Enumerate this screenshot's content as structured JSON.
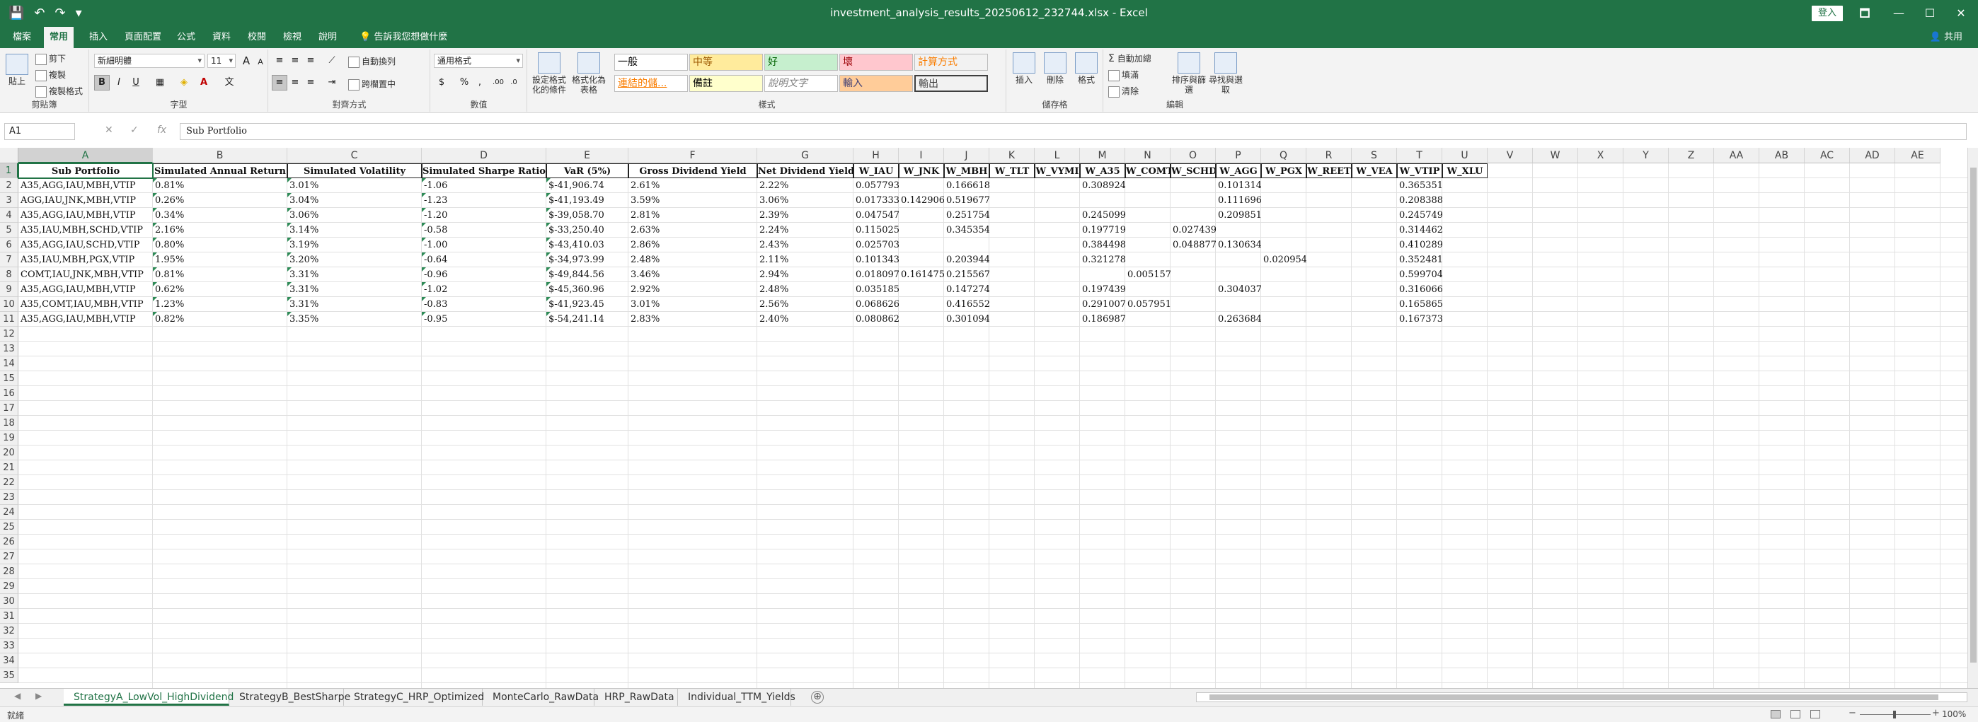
{
  "window": {
    "title": "investment_analysis_results_20250612_232744.xlsx  -  Excel",
    "sign_in": "登入",
    "share": "共用",
    "controls": [
      "🗖",
      "—",
      "☐",
      "✕"
    ]
  },
  "qat": [
    "💾",
    "↶",
    "↷",
    "▾"
  ],
  "ribbon_tabs": [
    "檔案",
    "常用",
    "插入",
    "頁面配置",
    "公式",
    "資料",
    "校閱",
    "檢視",
    "說明"
  ],
  "tell_me": "告訴我您想做什麼",
  "ribbon": {
    "clipboard": {
      "paste": "貼上",
      "cut": "剪下",
      "copy": "複製",
      "format_painter": "複製格式",
      "label": "剪貼簿"
    },
    "font": {
      "name": "新細明體",
      "size": "11",
      "label": "字型",
      "bold": "B",
      "italic": "I",
      "underline": "U",
      "grow": "A",
      "shrink": "A"
    },
    "alignment": {
      "wrap": "自動換列",
      "merge": "跨欄置中",
      "label": "對齊方式"
    },
    "number": {
      "format": "通用格式",
      "currency": "$",
      "percent": "%",
      "comma": ",",
      "label": "數值"
    },
    "styles": {
      "conditional": "設定格式化的條件",
      "table": "格式化為表格",
      "cells": [
        {
          "text": "一般",
          "bg": "#ffffff",
          "fg": "#000000"
        },
        {
          "text": "中等",
          "bg": "#ffeb9c",
          "fg": "#9c5700"
        },
        {
          "text": "好",
          "bg": "#c6efce",
          "fg": "#006100"
        },
        {
          "text": "壞",
          "bg": "#ffc7ce",
          "fg": "#9c0006"
        },
        {
          "text": "計算方式",
          "bg": "#f2f2f2",
          "fg": "#fa7d00"
        },
        {
          "text": "連結的儲...",
          "bg": "#ffffff",
          "fg": "#fa7d00"
        },
        {
          "text": "備註",
          "bg": "#ffffcc",
          "fg": "#000000"
        },
        {
          "text": "說明文字",
          "bg": "#ffffff",
          "fg": "#7f7f7f"
        },
        {
          "text": "輸入",
          "bg": "#ffcc99",
          "fg": "#3f3f76"
        },
        {
          "text": "輸出",
          "bg": "#f2f2f2",
          "fg": "#3f3f3f"
        }
      ],
      "label": "樣式"
    },
    "cells_group": {
      "insert": "插入",
      "delete": "刪除",
      "format": "格式",
      "label": "儲存格"
    },
    "editing": {
      "autosum": "自動加總",
      "fill": "填滿",
      "clear": "清除",
      "sort": "排序與篩選",
      "find": "尋找與選取",
      "label": "編輯"
    }
  },
  "formula_bar": {
    "name_box": "A1",
    "fx": "fx",
    "content": "Sub Portfolio"
  },
  "columns": [
    "A",
    "B",
    "C",
    "D",
    "E",
    "F",
    "G",
    "H",
    "I",
    "J",
    "K",
    "L",
    "M",
    "N",
    "O",
    "P",
    "Q",
    "R",
    "S",
    "T",
    "U",
    "V",
    "W",
    "X",
    "Y",
    "Z",
    "AA",
    "AB",
    "AC",
    "AD",
    "AE"
  ],
  "row_numbers": [
    "1",
    "2",
    "3",
    "4",
    "5",
    "6",
    "7",
    "8",
    "9",
    "10",
    "11",
    "12",
    "13",
    "14",
    "15",
    "16",
    "17",
    "18",
    "19",
    "20",
    "21",
    "22",
    "23",
    "24",
    "25",
    "26",
    "27",
    "28",
    "29",
    "30",
    "31",
    "32",
    "33",
    "34",
    "35"
  ],
  "headers": [
    "Sub Portfolio",
    "Simulated Annual Return",
    "Simulated Volatility",
    "Simulated Sharpe Ratio",
    "VaR (5%)",
    "Gross Dividend Yield",
    "Net Dividend Yield",
    "W_IAU",
    "W_JNK",
    "W_MBH",
    "W_TLT",
    "W_VYMI",
    "W_A35",
    "W_COMT",
    "W_SCHD",
    "W_AGG",
    "W_PGX",
    "W_REET",
    "W_VEA",
    "W_VTIP",
    "W_XLU"
  ],
  "rows": [
    [
      "A35,AGG,IAU,MBH,VTIP",
      "0.81%",
      "3.01%",
      "-1.06",
      "$-41,906.74",
      "2.61%",
      "2.22%",
      "0.057793",
      "",
      "0.166618",
      "",
      "",
      "0.308924",
      "",
      "",
      "0.101314",
      "",
      "",
      "",
      "0.365351",
      ""
    ],
    [
      "AGG,IAU,JNK,MBH,VTIP",
      "0.26%",
      "3.04%",
      "-1.23",
      "$-41,193.49",
      "3.59%",
      "3.06%",
      "0.017333",
      "0.142906",
      "0.519677",
      "",
      "",
      "",
      "",
      "",
      "0.111696",
      "",
      "",
      "",
      "0.208388",
      ""
    ],
    [
      "A35,AGG,IAU,MBH,VTIP",
      "0.34%",
      "3.06%",
      "-1.20",
      "$-39,058.70",
      "2.81%",
      "2.39%",
      "0.047547",
      "",
      "0.251754",
      "",
      "",
      "0.245099",
      "",
      "",
      "0.209851",
      "",
      "",
      "",
      "0.245749",
      ""
    ],
    [
      "A35,IAU,MBH,SCHD,VTIP",
      "2.16%",
      "3.14%",
      "-0.58",
      "$-33,250.40",
      "2.63%",
      "2.24%",
      "0.115025",
      "",
      "0.345354",
      "",
      "",
      "0.197719",
      "",
      "0.027439",
      "",
      "",
      "",
      "",
      "0.314462",
      ""
    ],
    [
      "A35,AGG,IAU,SCHD,VTIP",
      "0.80%",
      "3.19%",
      "-1.00",
      "$-43,410.03",
      "2.86%",
      "2.43%",
      "0.025703",
      "",
      "",
      "",
      "",
      "0.384498",
      "",
      "0.048877",
      "0.130634",
      "",
      "",
      "",
      "0.410289",
      ""
    ],
    [
      "A35,IAU,MBH,PGX,VTIP",
      "1.95%",
      "3.20%",
      "-0.64",
      "$-34,973.99",
      "2.48%",
      "2.11%",
      "0.101343",
      "",
      "0.203944",
      "",
      "",
      "0.321278",
      "",
      "",
      "",
      "0.020954",
      "",
      "",
      "0.352481",
      ""
    ],
    [
      "COMT,IAU,JNK,MBH,VTIP",
      "0.81%",
      "3.31%",
      "-0.96",
      "$-49,844.56",
      "3.46%",
      "2.94%",
      "0.018097",
      "0.161475",
      "0.215567",
      "",
      "",
      "",
      "0.005157",
      "",
      "",
      "",
      "",
      "",
      "0.599704",
      ""
    ],
    [
      "A35,AGG,IAU,MBH,VTIP",
      "0.62%",
      "3.31%",
      "-1.02",
      "$-45,360.96",
      "2.92%",
      "2.48%",
      "0.035185",
      "",
      "0.147274",
      "",
      "",
      "0.197439",
      "",
      "",
      "0.304037",
      "",
      "",
      "",
      "0.316066",
      ""
    ],
    [
      "A35,COMT,IAU,MBH,VTIP",
      "1.23%",
      "3.31%",
      "-0.83",
      "$-41,923.45",
      "3.01%",
      "2.56%",
      "0.068626",
      "",
      "0.416552",
      "",
      "",
      "0.291007",
      "0.057951",
      "",
      "",
      "",
      "",
      "",
      "0.165865",
      ""
    ],
    [
      "A35,AGG,IAU,MBH,VTIP",
      "0.82%",
      "3.35%",
      "-0.95",
      "$-54,241.14",
      "2.83%",
      "2.40%",
      "0.080862",
      "",
      "0.301094",
      "",
      "",
      "0.186987",
      "",
      "",
      "0.263684",
      "",
      "",
      "",
      "0.167373",
      ""
    ]
  ],
  "sheet_tabs": [
    "StrategyA_LowVol_HighDividend",
    "StrategyB_BestSharpe",
    "StrategyC_HRP_Optimized",
    "MonteCarlo_RawData",
    "HRP_RawData",
    "Individual_TTM_Yields"
  ],
  "active_sheet": 0,
  "add_sheet": "⊕",
  "status": {
    "ready": "就緒",
    "zoom": "100%"
  },
  "accent": "#217346"
}
